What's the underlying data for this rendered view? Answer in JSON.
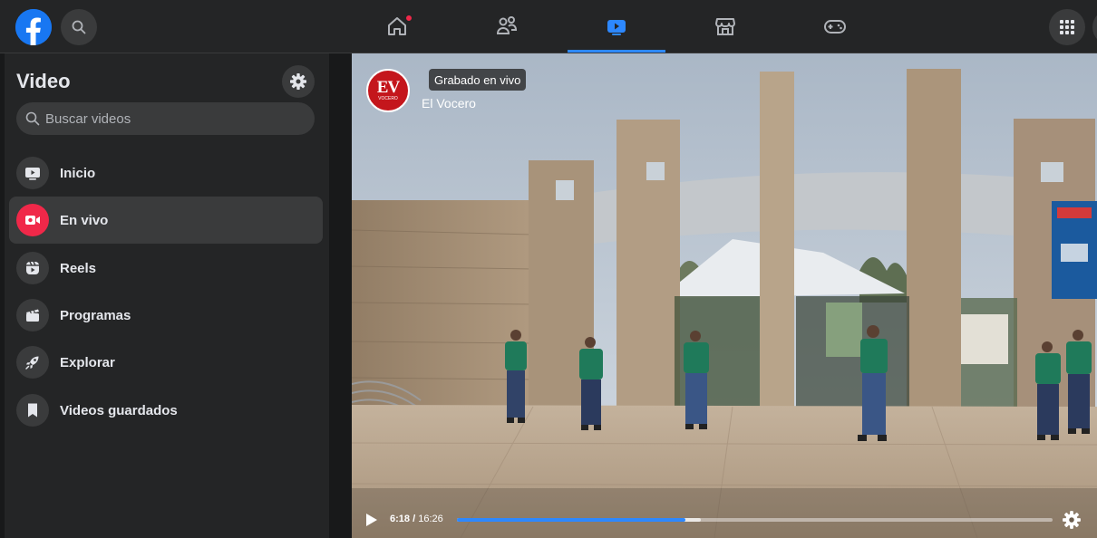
{
  "topbar": {
    "logo_icon": "facebook-logo",
    "search_icon": "search-icon",
    "tabs": [
      {
        "name": "home",
        "icon": "home-icon",
        "notification": true
      },
      {
        "name": "friends",
        "icon": "friends-icon"
      },
      {
        "name": "video",
        "icon": "video-icon",
        "active": true
      },
      {
        "name": "marketplace",
        "icon": "marketplace-icon"
      },
      {
        "name": "gaming",
        "icon": "gaming-icon"
      }
    ],
    "menu_icon": "menu-grid-icon"
  },
  "sidebar": {
    "title": "Video",
    "search_placeholder": "Buscar videos",
    "items": [
      {
        "label": "Inicio",
        "icon": "video-play-icon"
      },
      {
        "label": "En vivo",
        "icon": "live-camera-icon",
        "active": true
      },
      {
        "label": "Reels",
        "icon": "reels-icon"
      },
      {
        "label": "Programas",
        "icon": "clapperboard-icon"
      },
      {
        "label": "Explorar",
        "icon": "rocket-icon"
      },
      {
        "label": "Videos guardados",
        "icon": "bookmark-icon"
      }
    ]
  },
  "video": {
    "badge": "Grabado en vivo",
    "channel_name": "El Vocero",
    "channel_logo_text": "EV",
    "channel_logo_subtext": "VOCERO",
    "current_time": "6:18",
    "duration": "16:26",
    "progress": 0.384,
    "buffered": 0.41
  },
  "colors": {
    "accent": "#2d88ff",
    "live": "#f02849",
    "brand": "#1877f2"
  }
}
